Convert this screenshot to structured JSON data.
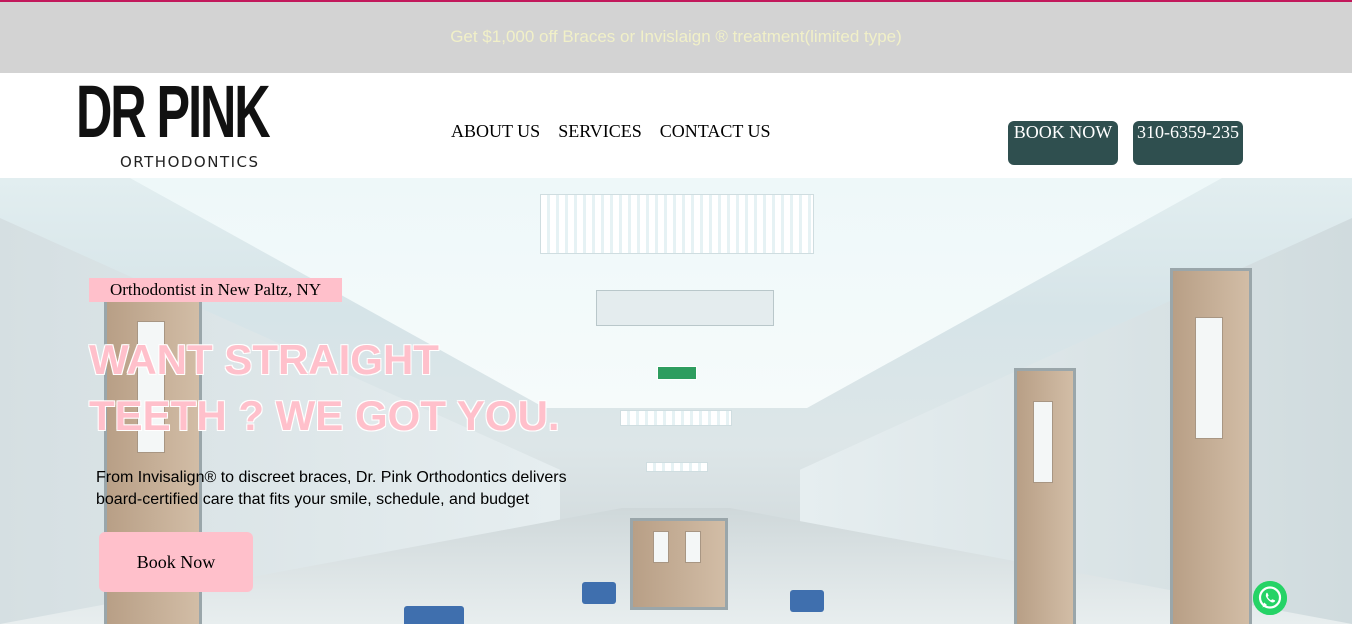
{
  "promo": {
    "text": "Get $1,000 off Braces or Invislaign ® treatment(limited type)"
  },
  "logo": {
    "main": "DR PINK",
    "sub": "ORTHODONTICS"
  },
  "nav": {
    "items": [
      {
        "label": "ABOUT US"
      },
      {
        "label": "SERVICES"
      },
      {
        "label": "CONTACT US"
      }
    ]
  },
  "cta": {
    "book_label": "BOOK NOW",
    "phone_label": "310-6359-235"
  },
  "hero": {
    "tag": "Orthodontist in New Paltz, NY",
    "headline_line1": "WANT STRAIGHT",
    "headline_line2": "TEETH ? WE GOT YOU.",
    "subtext": "From Invisalign® to discreet braces, Dr. Pink Orthodontics delivers board-certified care that fits your smile, schedule, and budget",
    "button_label": "Book Now"
  },
  "colors": {
    "promo_bg": "#d3d3d3",
    "promo_text": "#f1f0c8",
    "accent_pink": "#ffc0cb",
    "cta_dark": "#2f4f4f",
    "whatsapp": "#25d366"
  },
  "icons": {
    "floating": "whatsapp-icon"
  }
}
